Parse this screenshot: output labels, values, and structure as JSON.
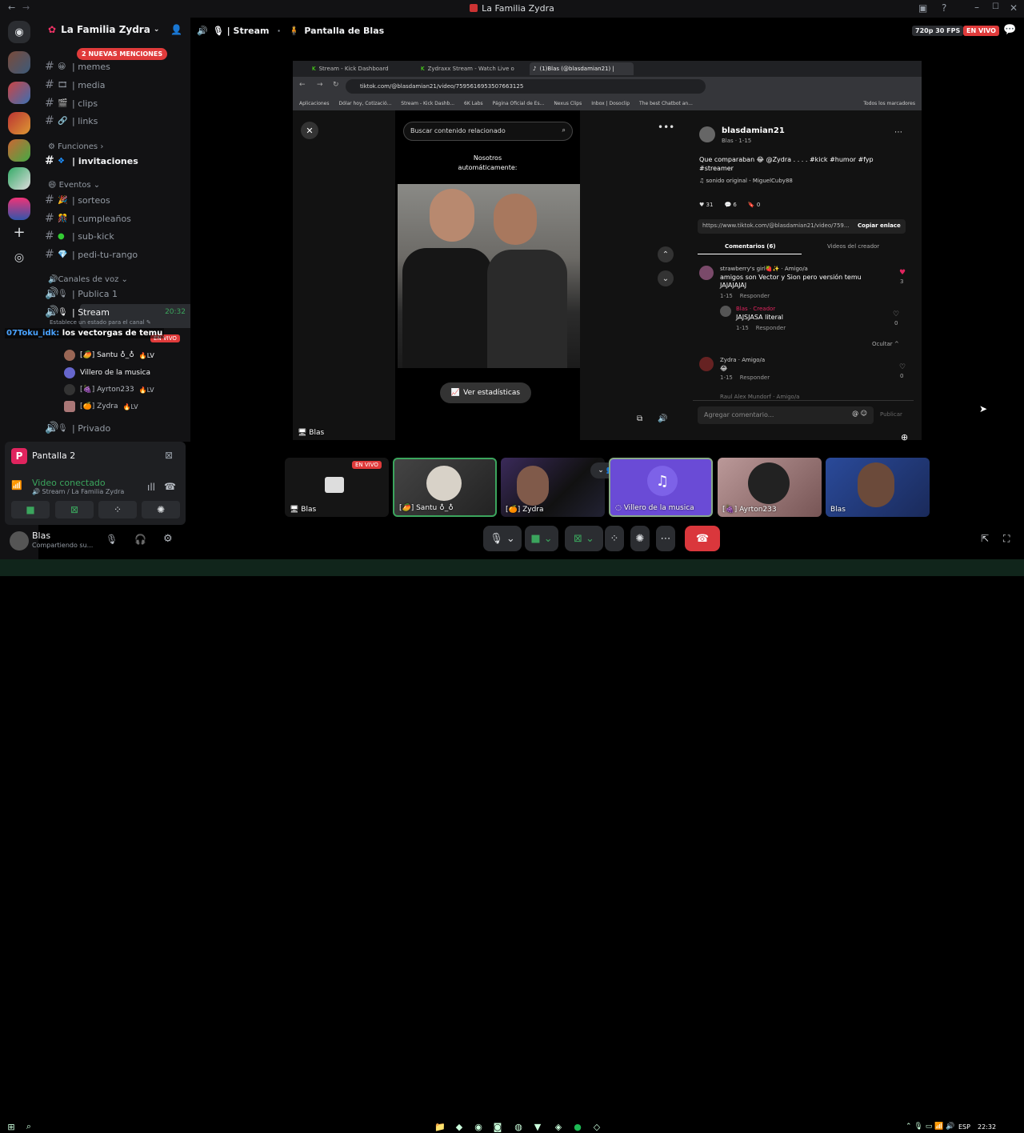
{
  "window": {
    "title": "La Familia Zydra"
  },
  "server": {
    "name": "La Familia Zydra",
    "mentions_badge": "2 NUEVAS MENCIONES"
  },
  "channels": {
    "text": [
      "memes",
      "media",
      "clips",
      "links"
    ],
    "funciones_label": "Funciones",
    "invitaciones": "invitaciones",
    "eventos_label": "Eventos",
    "eventos": [
      "sorteos",
      "cumpleaños",
      "sub-kick",
      "pedi-tu-rango"
    ],
    "voice_label": "Canales de voz",
    "voice": [
      "Publica 1",
      "Stream",
      "Privado"
    ],
    "stream_time": "20:32",
    "stream_status": "Establece un estado para el canal",
    "members": [
      {
        "name": "[🥭] Santu ♁_♁",
        "badge": "LV"
      },
      {
        "name": "Villero de la musica",
        "badge": ""
      },
      {
        "name": "[🍇] Ayrton233",
        "badge": "LV"
      },
      {
        "name": "[🍊] Zydra",
        "badge": "LV"
      }
    ],
    "live_badge": "EN VIVO"
  },
  "chat_overlay": {
    "user": "07Toku_idk:",
    "message": "los vectorgas de temu"
  },
  "voice_panel": {
    "pantalla": "Pantalla 2",
    "status": "Video conectado",
    "location": "Stream / La Familia Zydra"
  },
  "user_panel": {
    "name": "Blas",
    "status": "Compartiendo su..."
  },
  "header": {
    "channel": "Stream",
    "screen_label": "Pantalla de Blas",
    "quality": "720p 30 FPS",
    "live": "EN VIVO"
  },
  "browser": {
    "tabs": [
      "Stream - Kick Dashboard",
      "Zydraxx Stream - Watch Live o",
      "(1)Blas (@blasdamian21) |"
    ],
    "url": "tiktok.com/@blasdamian21/video/7595616953507663125",
    "bookmarks": [
      "Aplicaciones",
      "Dólar hoy, Cotizació...",
      "Stream - Kick Dashb...",
      "6K Labs",
      "Página Oficial de Es...",
      "Nexus Clips",
      "Inbox | Dosoclip",
      "The best Chatbot an...",
      "Todos los marcadores"
    ]
  },
  "tiktok": {
    "search_placeholder": "Buscar contenido relacionado",
    "video_caption_1": "Nosotros",
    "video_caption_2": "automáticamente:",
    "ver_estadisticas": "Ver estadísticas",
    "author": "blasdamian21",
    "author_sub": "Blas · 1-15",
    "description": "Que comparaban 😂 @Zydra . . . . #kick #humor #fyp #streamer",
    "sound": "sonido original - MiguelCuby88",
    "likes": "31",
    "comments_n": "6",
    "saves": "0",
    "link": "https://www.tiktok.com/@blasdamian21/video/759...",
    "copy": "Copiar enlace",
    "tab_comments": "Comentarios (6)",
    "tab_creator": "Videos del creador",
    "comments": [
      {
        "user": "strawberry's girl🍓✨ · Amigo/a",
        "text": "amigos son Vector y Sion pero versión temu JAJAJAJAJ",
        "meta": "1-15    Responder",
        "likes": "3"
      },
      {
        "user": "Blas · Creador",
        "text": "JAJSJASA literal",
        "meta": "1-15    Responder",
        "likes": "0"
      },
      {
        "user": "Zydra · Amigo/a",
        "text": "😂",
        "meta": "1-15    Responder",
        "likes": "0"
      }
    ],
    "ocultar": "Ocultar ^",
    "last_user": "Raul Alex Mundorf · Amigo/a",
    "add_comment": "Agregar comentario...",
    "publicar": "Publicar"
  },
  "stream_label": "Blas",
  "tiles": [
    {
      "label": "Blas",
      "live": "EN VIVO"
    },
    {
      "label": "[🥭] Santu ♁_♁"
    },
    {
      "label": "[🍊] Zydra"
    },
    {
      "label": "Villero de la musica"
    },
    {
      "label": "[🍇] Ayrton233"
    },
    {
      "label": "Blas"
    }
  ],
  "taskbar": {
    "lang": "ESP",
    "time": "22:32"
  }
}
